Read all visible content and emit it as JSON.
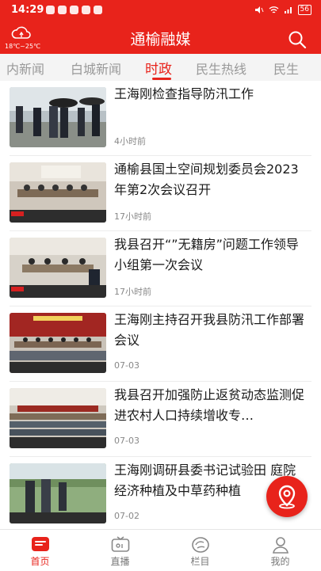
{
  "status_bar": {
    "time": "14:29",
    "battery": "56"
  },
  "header": {
    "title": "通榆融媒",
    "weather_temp": "18℃~25℃"
  },
  "tabs": [
    {
      "label": "内新闻"
    },
    {
      "label": "白城新闻"
    },
    {
      "label": "时政",
      "active": true
    },
    {
      "label": "民生热线"
    },
    {
      "label": "民生"
    }
  ],
  "news": [
    {
      "title": "王海刚检查指导防汛工作",
      "time": "4小时前"
    },
    {
      "title": "通榆县国土空间规划委员会2023年第2次会议召开",
      "time": "17小时前"
    },
    {
      "title": "我县召开“”无籍房”问题工作领导小组第一次会议",
      "time": "17小时前"
    },
    {
      "title": "王海刚主持召开我县防汛工作部署会议",
      "time": "07-03"
    },
    {
      "title": "我县召开加强防止返贫动态监测促进农村人口持续增收专…",
      "time": "07-03"
    },
    {
      "title": "王海刚调研县委书记试验田 庭院经济种植及中草药种植",
      "time": "07-02"
    }
  ],
  "bottom_nav": [
    {
      "label": "首页",
      "icon": "home-icon",
      "active": true
    },
    {
      "label": "直播",
      "icon": "live-tv-icon"
    },
    {
      "label": "栏目",
      "icon": "columns-icon"
    },
    {
      "label": "我的",
      "icon": "user-icon"
    }
  ],
  "colors": {
    "brand_red": "#e8231b",
    "tab_inactive": "#999999",
    "time_gray": "#888888"
  }
}
